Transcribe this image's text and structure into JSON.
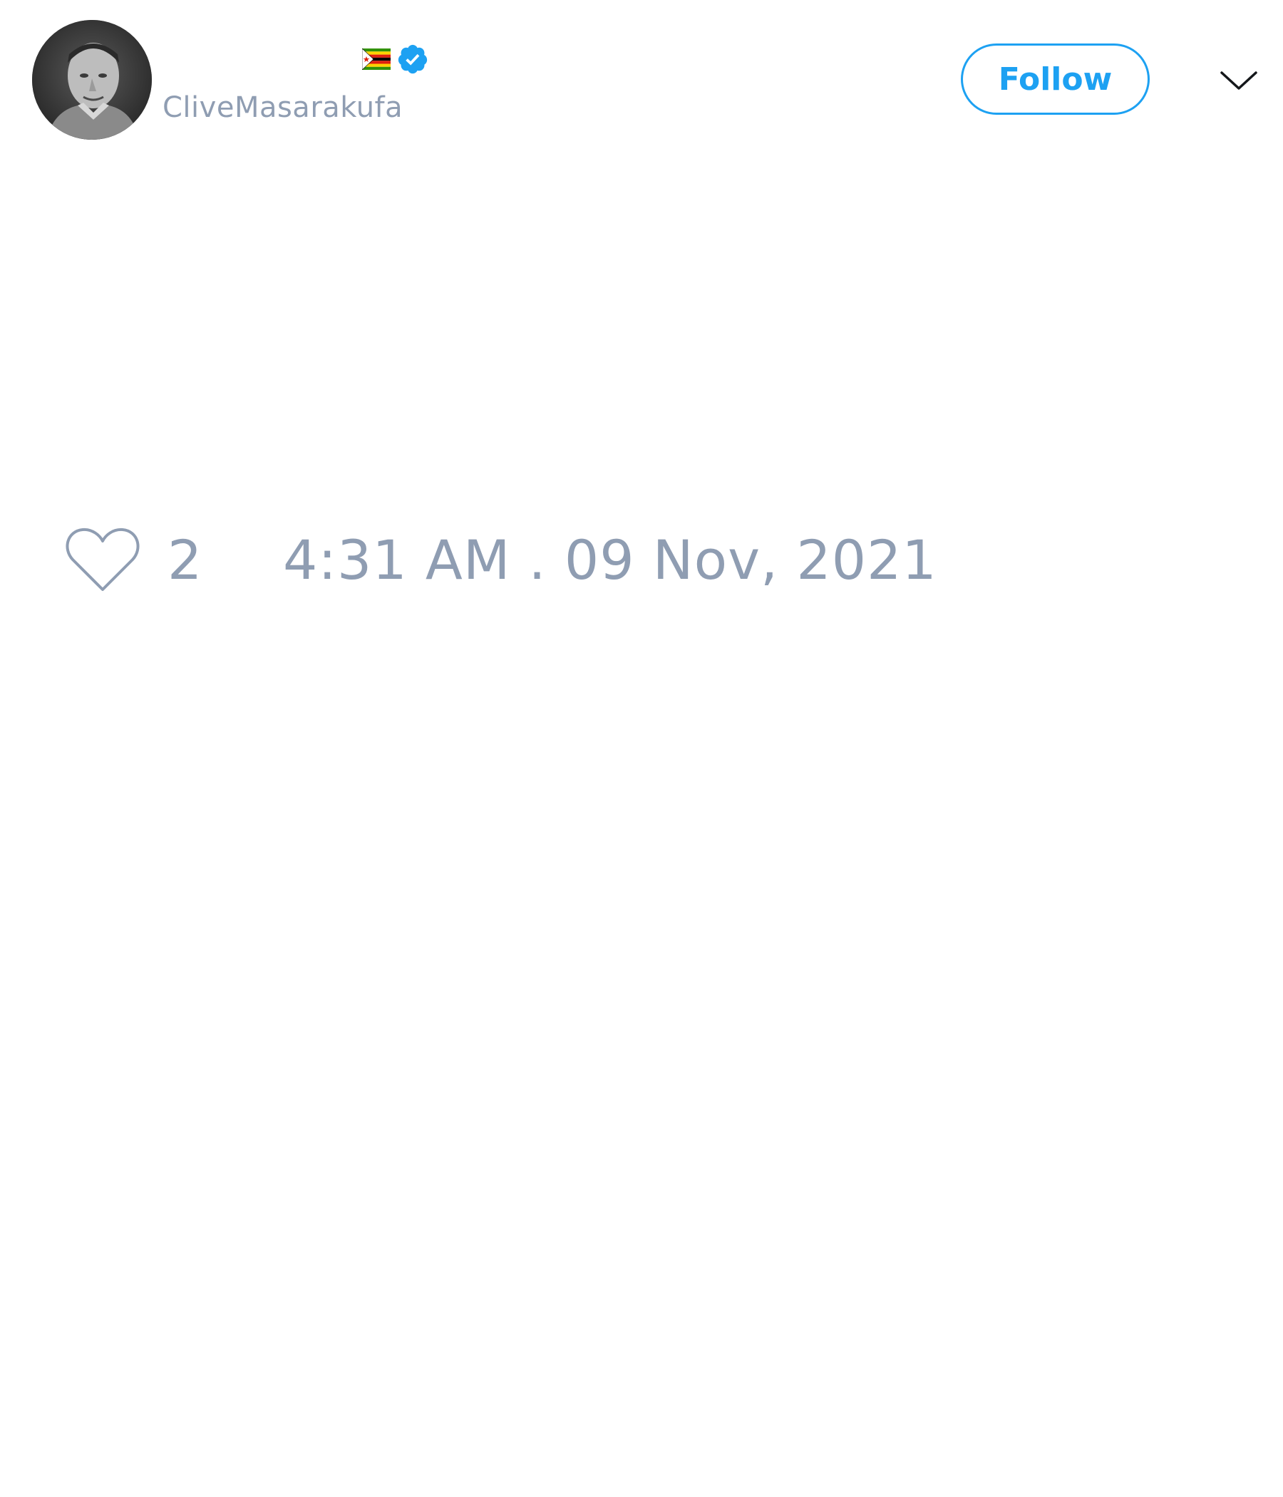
{
  "author": {
    "display_name": "",
    "handle": "CliveMasarakufa",
    "avatar_icon": "profile-photo",
    "flag_icon": "zimbabwe-flag-icon",
    "verified_icon": "verified-badge-icon"
  },
  "header": {
    "follow_label": "Follow",
    "menu_icon": "chevron-down-icon"
  },
  "tweet": {
    "like_icon": "heart-icon",
    "like_count": "2",
    "timestamp": "4:31 AM . 09 Nov, 2021"
  },
  "colors": {
    "accent": "#1da1f2",
    "muted_text": "#8f9db2",
    "background": "#ffffff"
  }
}
